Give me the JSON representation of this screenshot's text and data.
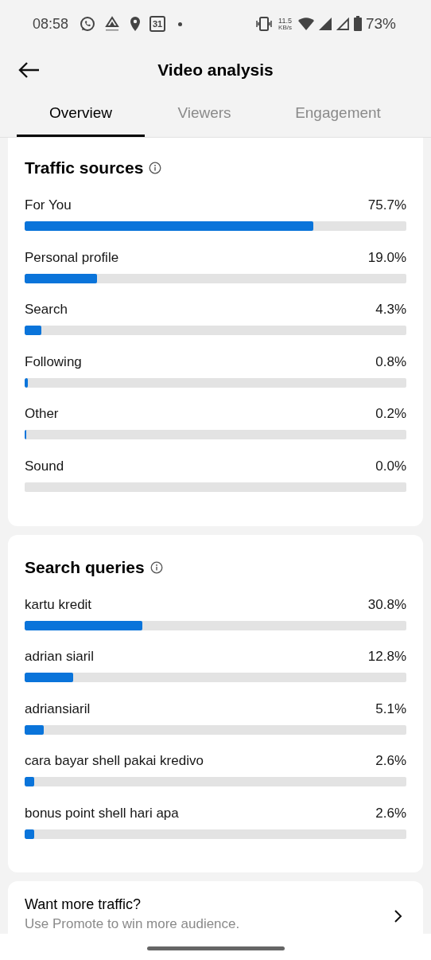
{
  "status_bar": {
    "time": "08:58",
    "calendar_day": "31",
    "net_speed": "11.5",
    "net_unit": "KB/s",
    "battery": "73%"
  },
  "header": {
    "title": "Video analysis"
  },
  "tabs": [
    {
      "label": "Overview",
      "selected": true
    },
    {
      "label": "Viewers",
      "selected": false
    },
    {
      "label": "Engagement",
      "selected": false
    }
  ],
  "sections": [
    {
      "title": "Traffic sources",
      "rows": [
        {
          "label": "For You",
          "value": "75.7%",
          "level": 0.757
        },
        {
          "label": "Personal profile",
          "value": "19.0%",
          "level": 0.19
        },
        {
          "label": "Search",
          "value": "4.3%",
          "level": 0.043
        },
        {
          "label": "Following",
          "value": "0.8%",
          "level": 0.008
        },
        {
          "label": "Other",
          "value": "0.2%",
          "level": 0.002
        },
        {
          "label": "Sound",
          "value": "0.0%",
          "level": 0
        }
      ]
    },
    {
      "title": "Search queries",
      "rows": [
        {
          "label": "kartu kredit",
          "value": "30.8%",
          "level": 0.308
        },
        {
          "label": "adrian siaril",
          "value": "12.8%",
          "level": 0.128
        },
        {
          "label": "adriansiaril",
          "value": "5.1%",
          "level": 0.051
        },
        {
          "label": "cara bayar shell pakai kredivo",
          "value": "2.6%",
          "level": 0.026
        },
        {
          "label": "bonus point shell hari apa",
          "value": "2.6%",
          "level": 0.026
        }
      ]
    }
  ],
  "promo": {
    "title": "Want more traffic?",
    "subtitle": "Use Promote to win more audience."
  }
}
